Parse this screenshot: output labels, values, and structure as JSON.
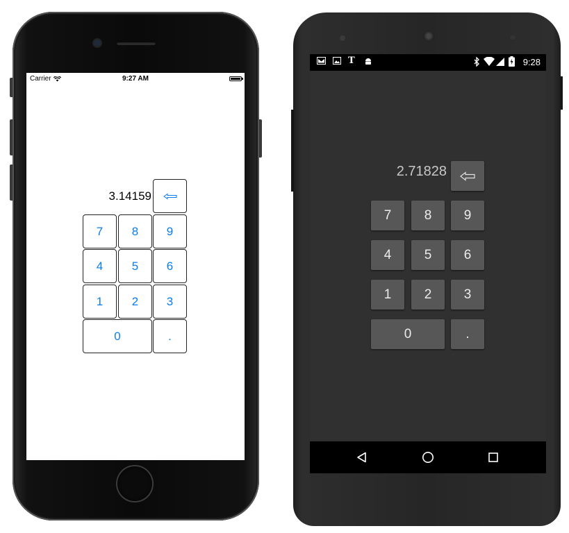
{
  "ios": {
    "status": {
      "carrier": "Carrier",
      "time": "9:27 AM"
    },
    "display": "3.14159",
    "keys": {
      "k7": "7",
      "k8": "8",
      "k9": "9",
      "k4": "4",
      "k5": "5",
      "k6": "6",
      "k1": "1",
      "k2": "2",
      "k3": "3",
      "k0": "0",
      "dot": "."
    },
    "accent_color": "#0a7cf0"
  },
  "android": {
    "status": {
      "time": "9:28"
    },
    "display": "2.71828",
    "keys": {
      "k7": "7",
      "k8": "8",
      "k9": "9",
      "k4": "4",
      "k5": "5",
      "k6": "6",
      "k1": "1",
      "k2": "2",
      "k3": "3",
      "k0": "0",
      "dot": "."
    },
    "key_color": "#575757"
  }
}
